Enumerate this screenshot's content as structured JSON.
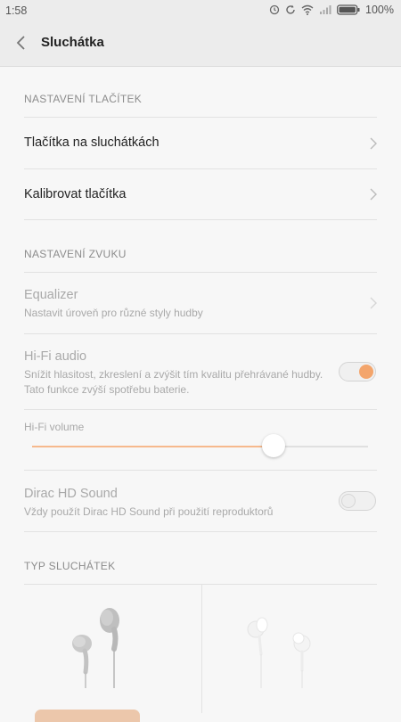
{
  "status_bar": {
    "time": "1:58",
    "battery": "100%"
  },
  "header": {
    "title": "Sluchátka"
  },
  "sections": {
    "buttons_header": "NASTAVENÍ TLAČÍTEK",
    "sound_header": "NASTAVENÍ ZVUKU",
    "type_header": "TYP SLUCHÁTEK"
  },
  "rows": {
    "headset_buttons": {
      "title": "Tlačítka na sluchátkách"
    },
    "calibrate_buttons": {
      "title": "Kalibrovat tlačítka"
    },
    "equalizer": {
      "title": "Equalizer",
      "subtitle": "Nastavit úroveň pro různé styly hudby"
    },
    "hifi_audio": {
      "title": "Hi-Fi audio",
      "subtitle": "Snížit hlasitost, zkreslení a zvýšit tím kvalitu přehrávané hudby. Tato funkce zvýší spotřebu baterie.",
      "enabled": true
    },
    "hifi_volume": {
      "title": "Hi-Fi volume",
      "level": 0.72
    },
    "dirac": {
      "title": "Dirac HD Sound",
      "subtitle": "Vždy použít Dirac HD Sound při použití reproduktorů",
      "enabled": false
    }
  },
  "earphone_types": [
    "earbud-earphones-icon",
    "in-ear-earphones-icon"
  ],
  "colors": {
    "accent": "#f3a56c",
    "background": "#f7f7f7"
  }
}
